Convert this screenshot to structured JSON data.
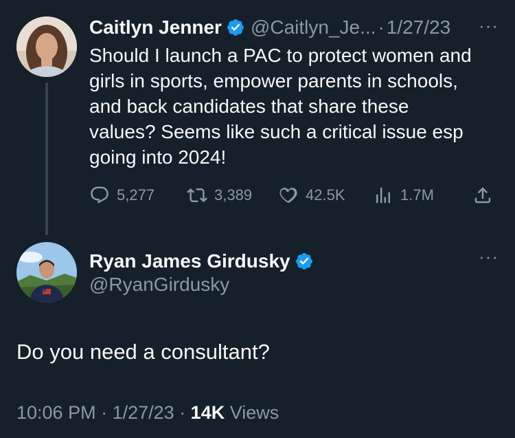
{
  "tweet1": {
    "name": "Caitlyn Jenner",
    "handle": "@Caitlyn_Je...",
    "separator": "·",
    "date": "1/27/23",
    "more_icon": "···",
    "text": "Should I launch a PAC to protect women and girls in sports, empower parents in schools, and back candidates that share these values? Seems like such a critical issue esp going into 2024!",
    "replies": "5,277",
    "retweets": "3,389",
    "likes": "42.5K",
    "views": "1.7M"
  },
  "tweet2": {
    "name": "Ryan James Girdusky",
    "handle": "@RyanGirdusky",
    "more_icon": "···",
    "text": "Do you need a consultant?",
    "time": "10:06 PM",
    "sep1": " · ",
    "date": "1/27/23",
    "sep2": " · ",
    "views_count": "14K",
    "views_label": " Views"
  },
  "icons": {
    "verified": "verified-badge-icon",
    "reply": "reply-icon",
    "retweet": "retweet-icon",
    "like": "heart-icon",
    "views": "views-bar-icon",
    "share": "share-icon",
    "more": "more-dots-icon"
  },
  "colors": {
    "background": "#15202b",
    "primary_text": "#f7f9f9",
    "secondary_text": "#8b98a5",
    "verified_blue": "#1d9bf0",
    "thread_line": "#38444d"
  }
}
